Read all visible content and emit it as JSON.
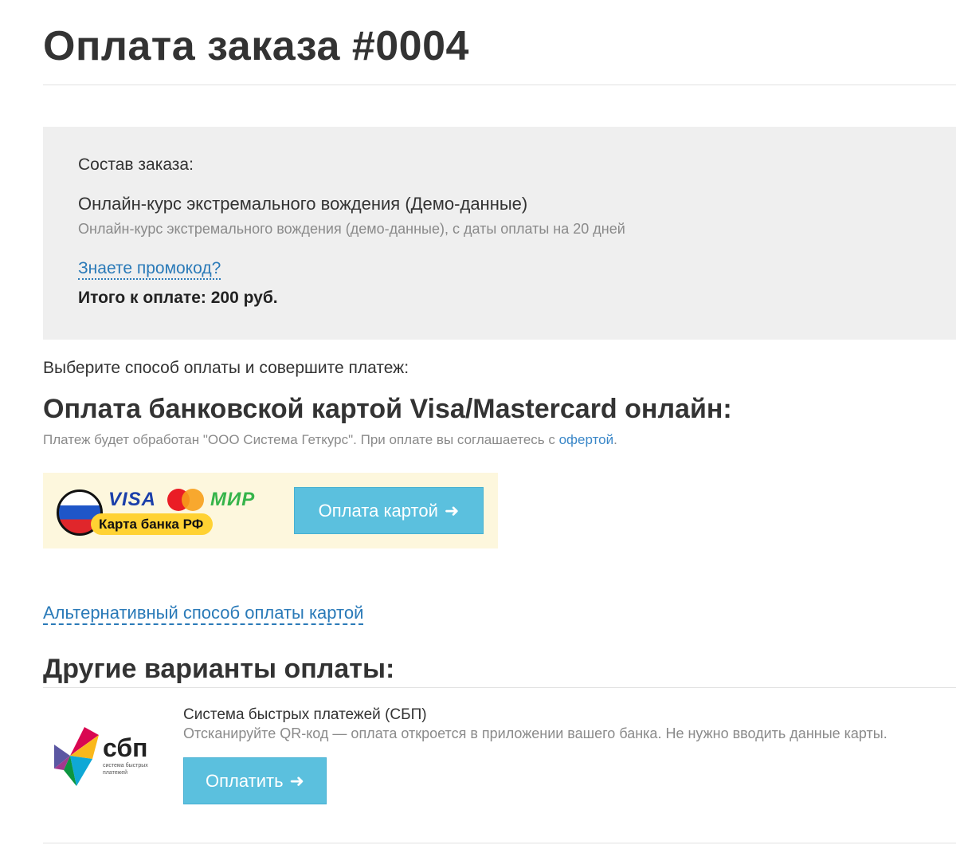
{
  "page": {
    "title": "Оплата заказа #0004"
  },
  "order": {
    "heading": "Состав заказа:",
    "item_name": "Онлайн-курс экстремального вождения (Демо-данные)",
    "item_desc": "Онлайн-курс экстремального вождения (демо-данные), с даты оплаты на 20 дней",
    "promo_link": "Знаете промокод?",
    "total": "Итого к оплате: 200 руб."
  },
  "payment": {
    "choose_text": "Выберите способ оплаты и совершите платеж:",
    "card": {
      "heading": "Оплата банковской картой Visa/Mastercard онлайн:",
      "note_before": "Платеж будет обработан \"ООО Система Геткурс\". При оплате вы соглашаетесь с ",
      "note_link": "офертой",
      "note_after": ".",
      "logo_visa": "VISA",
      "logo_mir": "МИР",
      "logo_badge": "Карта банка РФ",
      "button_label": "Оплата картой",
      "button_icon": "arrow-right-icon"
    },
    "alt_link": "Альтернативный способ оплаты картой",
    "others": {
      "heading": "Другие варианты оплаты:",
      "sbp": {
        "logo_word": "сбп",
        "logo_sub": "система быстрых платежей",
        "title": "Система быстрых платежей (СБП)",
        "desc": "Отсканируйте QR-код — оплата откроется в приложении вашего банка. Не нужно вводить данные карты.",
        "button_label": "Оплатить",
        "button_icon": "arrow-right-icon"
      }
    }
  },
  "colors": {
    "button_bg": "#5bc0de",
    "link": "#2a7ab8",
    "order_box_bg": "#efefef",
    "card_block_bg": "#fdf7dd"
  }
}
